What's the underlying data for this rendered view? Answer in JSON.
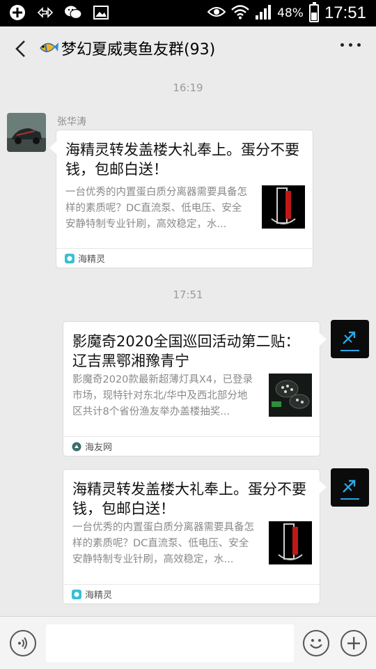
{
  "status_bar": {
    "battery": "48%",
    "time": "17:51",
    "icons": [
      "add-circle-icon",
      "signal-arrows-icon",
      "wechat-icon",
      "image-icon",
      "eye-icon",
      "wifi-icon",
      "cell-signal-icon",
      "battery-icon"
    ]
  },
  "header": {
    "title": "梦幻夏威夷鱼友群(93)",
    "back_icon": "back-chevron-icon",
    "more_icon": "more-dots-icon"
  },
  "messages": [
    {
      "timestamp": "16:19",
      "sender": "张华涛",
      "side": "left",
      "title": "海精灵转发盖楼大礼奉上。蛋分不要钱，包邮白送！",
      "desc": "一台优秀的内置蛋白质分离器需要具备怎样的素质呢？DC直流泵、低电压、安全安静特制专业针刷，高效稳定，水...",
      "source": "海精灵"
    },
    {
      "timestamp": "17:51",
      "side": "right",
      "title": "影魔奇2020全国巡回活动第二贴：辽吉黑鄂湘豫青宁",
      "desc": "影魔奇2020款最新超薄灯具X4，已登录市场，现特针对东北/华中及西北部分地区共计8个省份渔友举办盖楼抽奖...",
      "source": "海友网"
    },
    {
      "side": "right",
      "title": "海精灵转发盖楼大礼奉上。蛋分不要钱，包邮白送！",
      "desc": "一台优秀的内置蛋白质分离器需要具备怎样的素质呢？DC直流泵、低电压、安全安静特制专业针刷，高效稳定，水...",
      "source": "海精灵"
    }
  ],
  "input_bar": {
    "voice_icon": "voice-icon",
    "emoji_icon": "emoji-icon",
    "plus_icon": "plus-icon",
    "input_value": ""
  }
}
